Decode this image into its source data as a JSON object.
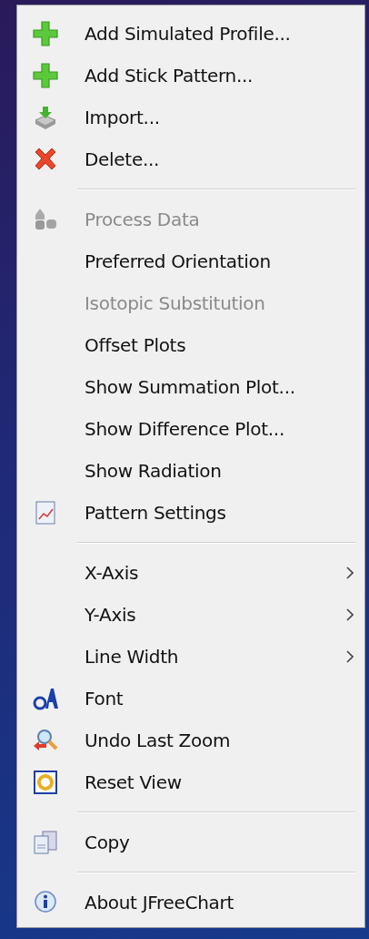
{
  "menu": {
    "groups": [
      {
        "items": [
          {
            "label": "Add Simulated Profile...",
            "disabled": false,
            "submenu": false
          },
          {
            "label": "Add Stick Pattern...",
            "disabled": false,
            "submenu": false
          },
          {
            "label": "Import...",
            "disabled": false,
            "submenu": false
          },
          {
            "label": "Delete...",
            "disabled": false,
            "submenu": false
          }
        ]
      },
      {
        "items": [
          {
            "label": "Process Data",
            "disabled": true,
            "submenu": false
          },
          {
            "label": "Preferred Orientation",
            "disabled": false,
            "submenu": false
          },
          {
            "label": "Isotopic Substitution",
            "disabled": true,
            "submenu": false
          },
          {
            "label": "Offset Plots",
            "disabled": false,
            "submenu": false
          },
          {
            "label": "Show Summation Plot...",
            "disabled": false,
            "submenu": false
          },
          {
            "label": "Show Difference Plot...",
            "disabled": false,
            "submenu": false
          },
          {
            "label": "Show Radiation",
            "disabled": false,
            "submenu": false
          },
          {
            "label": "Pattern Settings",
            "disabled": false,
            "submenu": false
          }
        ]
      },
      {
        "items": [
          {
            "label": "X-Axis",
            "disabled": false,
            "submenu": true
          },
          {
            "label": "Y-Axis",
            "disabled": false,
            "submenu": true
          },
          {
            "label": "Line Width",
            "disabled": false,
            "submenu": true
          },
          {
            "label": "Font",
            "disabled": false,
            "submenu": false
          },
          {
            "label": "Undo Last Zoom",
            "disabled": false,
            "submenu": false
          },
          {
            "label": "Reset View",
            "disabled": false,
            "submenu": false
          }
        ]
      },
      {
        "items": [
          {
            "label": "Copy",
            "disabled": false,
            "submenu": false
          }
        ]
      },
      {
        "items": [
          {
            "label": "About JFreeChart",
            "disabled": false,
            "submenu": false
          }
        ]
      }
    ]
  }
}
